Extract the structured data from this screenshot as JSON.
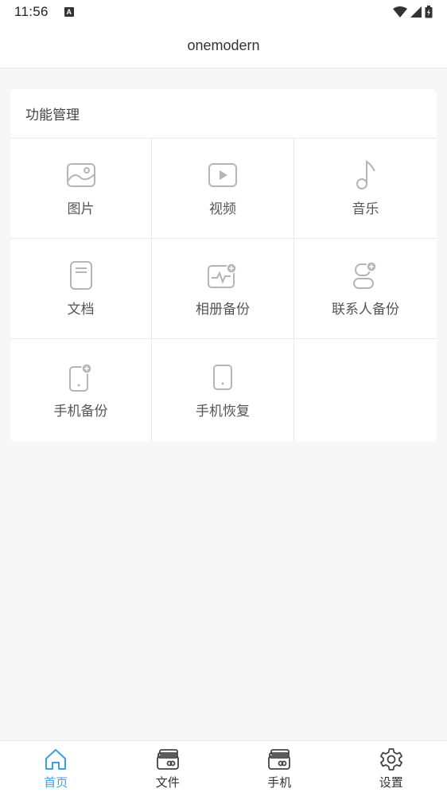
{
  "status_bar": {
    "time": "11:56",
    "notification_icon": "A",
    "icons": [
      "wifi-icon",
      "signal-icon",
      "battery-icon"
    ]
  },
  "header": {
    "title": "onemodern"
  },
  "card": {
    "title": "功能管理",
    "items": [
      {
        "label": "图片",
        "icon": "image-icon"
      },
      {
        "label": "视频",
        "icon": "video-icon"
      },
      {
        "label": "音乐",
        "icon": "music-icon"
      },
      {
        "label": "文档",
        "icon": "document-icon"
      },
      {
        "label": "相册备份",
        "icon": "album-backup-icon"
      },
      {
        "label": "联系人备份",
        "icon": "contact-backup-icon"
      },
      {
        "label": "手机备份",
        "icon": "phone-backup-icon"
      },
      {
        "label": "手机恢复",
        "icon": "phone-restore-icon"
      }
    ]
  },
  "tab_bar": {
    "tabs": [
      {
        "label": "首页",
        "icon": "home-icon",
        "active": true
      },
      {
        "label": "文件",
        "icon": "files-icon",
        "active": false
      },
      {
        "label": "手机",
        "icon": "phone-wallet-icon",
        "active": false
      },
      {
        "label": "设置",
        "icon": "settings-gear-icon",
        "active": false
      }
    ]
  },
  "colors": {
    "accent": "#3aa0e8",
    "icon_gray": "#b5b5b5",
    "background": "#f7f7f7"
  }
}
